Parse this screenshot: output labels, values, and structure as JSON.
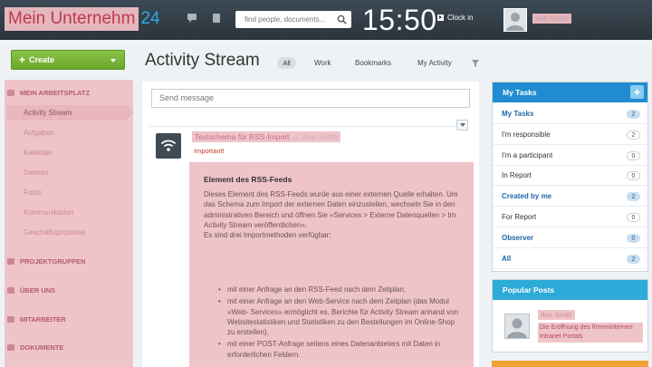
{
  "header": {
    "logo_text": "Mein Unternehm",
    "logo_num": "24",
    "icons": [
      "message-icon",
      "notification-icon",
      "search-icon"
    ],
    "search_placeholder": "find people, documents...",
    "time": "15:50",
    "clock_in_label": "Clock in",
    "user_name": "Ann Smith"
  },
  "sidebar": {
    "create_label": "Create",
    "sections": [
      {
        "label": "MEIN ARBEITSPLATZ",
        "icon": "home-icon"
      },
      {
        "label": "PROJEKTGRUPPEN",
        "icon": "group-icon"
      },
      {
        "label": "ÜBER UNS",
        "icon": "house-icon"
      },
      {
        "label": "MITARBEITER",
        "icon": "people-icon"
      },
      {
        "label": "DOKUMENTE",
        "icon": "documents-icon"
      }
    ],
    "items": [
      {
        "label": "Activity Stream",
        "active": true
      },
      {
        "label": "Aufgaben"
      },
      {
        "label": "Kalender"
      },
      {
        "label": "Dateien"
      },
      {
        "label": "Fotos"
      },
      {
        "label": "Kommunikation"
      },
      {
        "label": "Geschäftsprozesse"
      }
    ]
  },
  "main": {
    "title": "Activity Stream",
    "filters": [
      "All",
      "Work",
      "Bookmarks",
      "My Activity"
    ],
    "send_placeholder": "Send message",
    "post": {
      "icon": "rss-icon",
      "title": "Testschema für RSS-Import",
      "arrow": "→",
      "recipient": "Ann Smith",
      "important": "Important!",
      "heading": "Element des RSS-Feeds",
      "paragraph": "Dieses Element des RSS-Feeds wurde aus einer externen Quelle erhalten. Um das Schema zum Import der externen Daten einzustellen, wechseln Sie in den administrativen Bereich und öffnen Sie «Services > Externe Datenquellen > Im Activity Stream veröffentlichen».",
      "intro": "Es sind drei Importmethoden verfügbar:",
      "methods": [
        "mit einer Anfrage an den RSS-Feed nach dem Zeitplan,",
        "mit einer Anfrage an den Web-Service nach dem Zeitplan (das Modul «Web- Services» ermöglicht es, Berichte für Activity Stream anhand von Websitestatistiken und Statistiken zu den Bestellungen im Online-Shop zu erstellen),",
        "mit einer POST-Anfrage seitens eines Datenanbieters mit Daten in erforderlichen Feldern."
      ]
    }
  },
  "tasks": {
    "title": "My Tasks",
    "add_label": "+",
    "rows": [
      {
        "label": "My Tasks",
        "count": "2",
        "bold": true,
        "highlight": true
      },
      {
        "label": "I'm responsible",
        "count": "2",
        "bold": false,
        "highlight": false
      },
      {
        "label": "I'm a participant",
        "count": "0",
        "bold": false,
        "highlight": false
      },
      {
        "label": "In Report",
        "count": "0",
        "bold": false,
        "highlight": false
      },
      {
        "label": "Created by me",
        "count": "2",
        "bold": true,
        "highlight": true
      },
      {
        "label": "For Report",
        "count": "0",
        "bold": false,
        "highlight": false
      },
      {
        "label": "Observer",
        "count": "0",
        "bold": true,
        "highlight": true
      },
      {
        "label": "All",
        "count": "2",
        "bold": true,
        "highlight": true
      }
    ]
  },
  "popular": {
    "title": "Popular Posts",
    "author": "Ann Smith",
    "post_title": "Die Eröffnung des firmeninternen Intranet Portals"
  },
  "colors": {
    "topbar": "#2b343c",
    "accent_blue": "#1f8ccf",
    "create_green": "#6aa72b",
    "highlight_pink": "#efc4c8",
    "important_red": "#c0392b"
  }
}
